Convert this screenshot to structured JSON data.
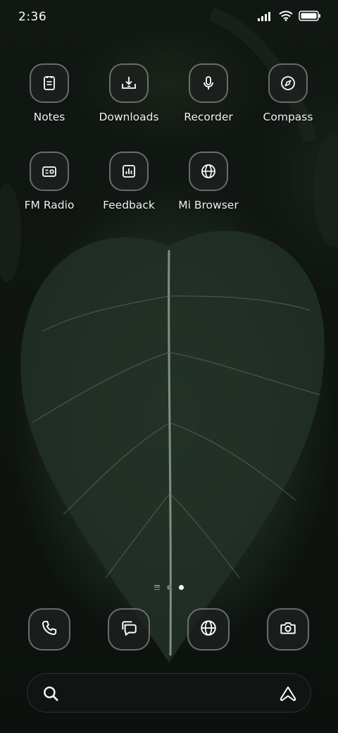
{
  "status_bar": {
    "time": "2:36",
    "icons": [
      "signal-icon",
      "wifi-icon",
      "battery-icon"
    ]
  },
  "apps_row1": [
    {
      "label": "Notes",
      "icon": "notes-icon"
    },
    {
      "label": "Downloads",
      "icon": "download-icon"
    },
    {
      "label": "Recorder",
      "icon": "microphone-icon"
    },
    {
      "label": "Compass",
      "icon": "compass-icon"
    }
  ],
  "apps_row2": [
    {
      "label": "FM Radio",
      "icon": "radio-icon"
    },
    {
      "label": "Feedback",
      "icon": "bar-chart-icon"
    },
    {
      "label": "Mi Browser",
      "icon": "globe-icon"
    }
  ],
  "page_indicator": {
    "pages": 2,
    "active_page": 2
  },
  "dock": [
    {
      "icon": "phone-icon"
    },
    {
      "icon": "messages-icon"
    },
    {
      "icon": "globe-icon"
    },
    {
      "icon": "camera-icon"
    }
  ],
  "search_bar": {
    "left_icon": "search-icon",
    "right_icon": "assistant-icon"
  },
  "colors": {
    "icon_border": "#8a8f8c",
    "text": "#ffffff",
    "wallpaper": "#0f1410"
  }
}
